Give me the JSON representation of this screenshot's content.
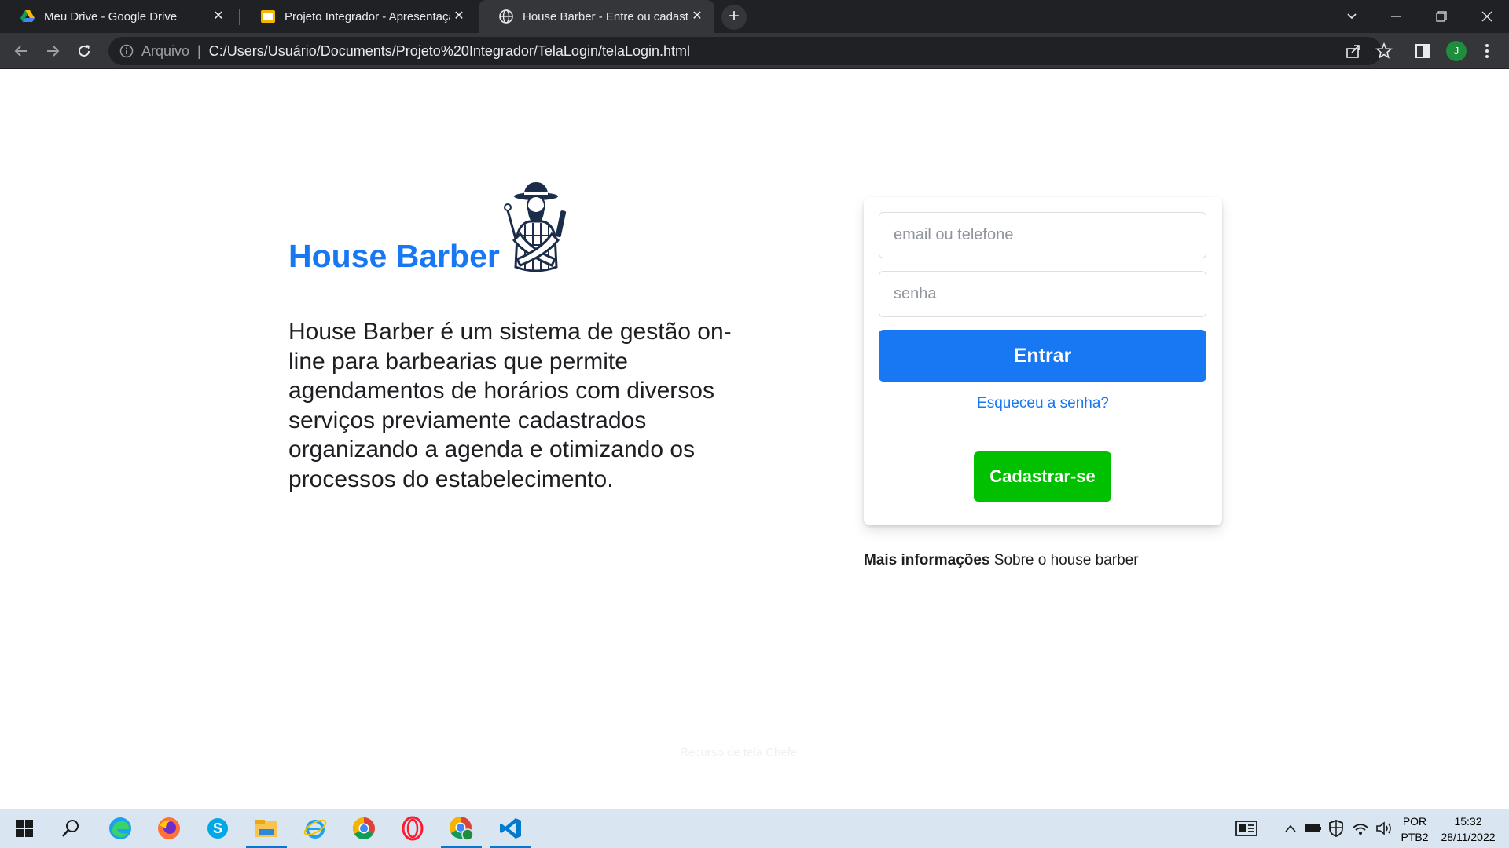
{
  "browser": {
    "tabs": [
      {
        "title": "Meu Drive - Google Drive",
        "icon": "google-drive-icon",
        "active": false
      },
      {
        "title": "Projeto Integrador - Apresentação",
        "icon": "google-slides-icon",
        "active": false
      },
      {
        "title": "House Barber - Entre ou cadastre-se",
        "icon": "globe-icon",
        "active": true
      }
    ],
    "address": {
      "scheme_label": "Arquivo",
      "separator": "|",
      "url": "C:/Users/Usuário/Documents/Projeto%20Integrador/TelaLogin/telaLogin.html"
    },
    "profile_initial": "J"
  },
  "page": {
    "brand": {
      "title": "House Barber",
      "logo_icon": "bearded-barber-logo"
    },
    "description": "House Barber é um sistema de gestão on-line para barbearias que permite agendamentos de horários com diversos serviços previamente cadastrados organizando a agenda e otimizando os processos do estabelecimento.",
    "login_form": {
      "email_placeholder": "email ou telefone",
      "password_placeholder": "senha",
      "login_button": "Entrar",
      "forgot_link": "Esqueceu a senha?",
      "signup_button": "Cadastrar-se"
    },
    "more_info": {
      "label": "Mais informações",
      "text": "Sobre o house barber"
    },
    "faded_text": "Recurso de tela Chefe"
  },
  "taskbar": {
    "apps": [
      "windows-start-icon",
      "search-icon",
      "edge-icon",
      "firefox-icon",
      "skype-icon",
      "file-explorer-icon",
      "internet-explorer-icon",
      "chrome-icon",
      "opera-icon",
      "chrome-profile-icon",
      "vscode-icon"
    ],
    "language_line1": "POR",
    "language_line2": "PTB2",
    "time": "15:32",
    "date": "28/11/2022"
  },
  "colors": {
    "brand_blue": "#1877f2",
    "signup_green": "#00c000",
    "chrome_dark": "#202124",
    "chrome_toolbar": "#35363a",
    "taskbar": "#d9e6f2"
  }
}
